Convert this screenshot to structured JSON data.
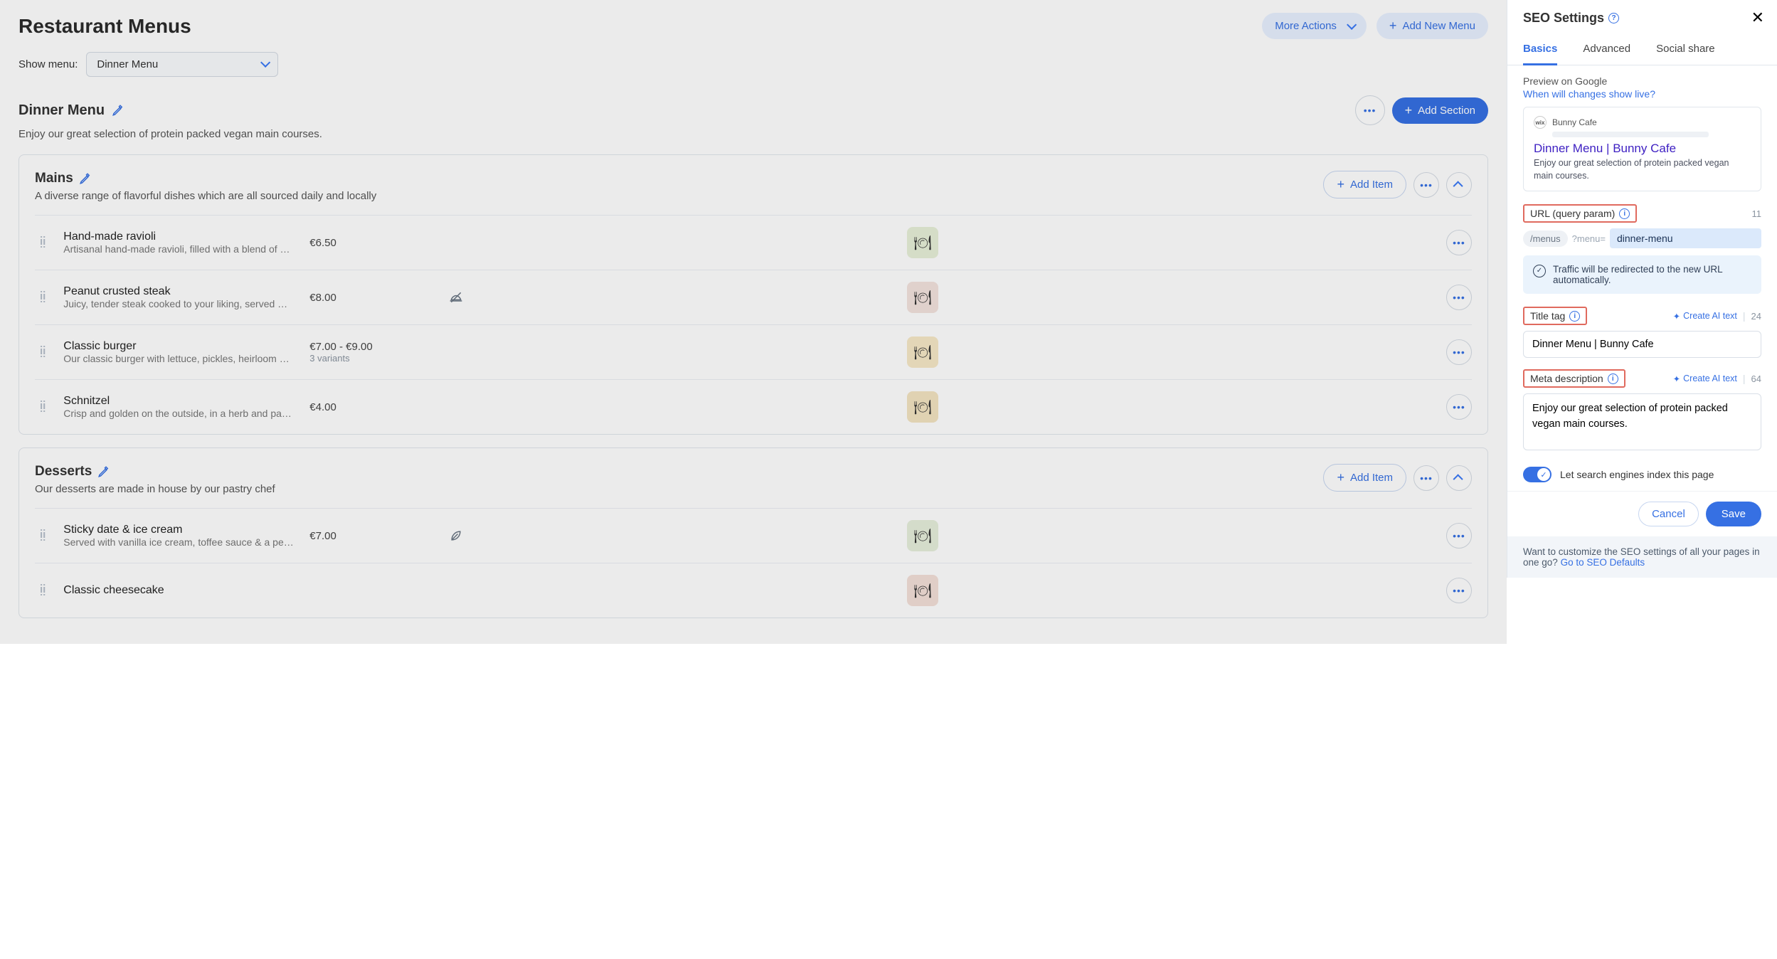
{
  "header": {
    "title": "Restaurant Menus",
    "more_actions": "More Actions",
    "add_new_menu": "Add New Menu"
  },
  "show_menu": {
    "label": "Show menu:",
    "selected": "Dinner Menu"
  },
  "menu": {
    "title": "Dinner Menu",
    "subtitle": "Enjoy our great selection of protein packed vegan main courses.",
    "add_section": "Add Section"
  },
  "sections": [
    {
      "title": "Mains",
      "subtitle": "A diverse range of flavorful dishes which are all sourced daily and locally",
      "add_item": "Add Item",
      "items": [
        {
          "name": "Hand-made ravioli",
          "desc": "Artisanal hand-made ravioli, filled with a blend of …",
          "price": "€6.50",
          "variants": "",
          "flag": "",
          "thumb": "#e8f0d8"
        },
        {
          "name": "Peanut crusted steak",
          "desc": "Juicy, tender steak cooked to your liking, served …",
          "price": "€8.00",
          "variants": "",
          "flag": "no-dish",
          "thumb": "#f3e3de"
        },
        {
          "name": "Classic burger",
          "desc": "Our classic burger with lettuce, pickles, heirloom …",
          "price": "€7.00 - €9.00",
          "variants": "3 variants",
          "flag": "",
          "thumb": "#f7e9c7"
        },
        {
          "name": "Schnitzel",
          "desc": "Crisp and golden on the outside, in a herb and pa…",
          "price": "€4.00",
          "variants": "",
          "flag": "",
          "thumb": "#f3e4c2"
        }
      ]
    },
    {
      "title": "Desserts",
      "subtitle": "Our desserts are made in house by our pastry chef",
      "add_item": "Add Item",
      "items": [
        {
          "name": "Sticky date & ice cream",
          "desc": "Served with vanilla ice cream, toffee sauce & a pe…",
          "price": "€7.00",
          "variants": "",
          "flag": "leaf",
          "thumb": "#e7efdc"
        },
        {
          "name": "Classic cheesecake",
          "desc": "",
          "price": "",
          "variants": "",
          "flag": "",
          "thumb": "#f3e0d8"
        }
      ]
    }
  ],
  "panel": {
    "title": "SEO Settings",
    "tabs": {
      "basics": "Basics",
      "advanced": "Advanced",
      "social": "Social share"
    },
    "preview_label": "Preview on Google",
    "preview_link": "When will changes show live?",
    "goog_site": "Bunny Cafe",
    "goog_title": "Dinner Menu | Bunny Cafe",
    "goog_desc": "Enjoy our great selection of protein packed vegan main courses.",
    "url_label": "URL (query param)",
    "url_count": "11",
    "url_path": "/menus",
    "url_query": "?menu=",
    "url_value": "dinner-menu",
    "redirect_notice": "Traffic will be redirected to the new URL automatically.",
    "title_label": "Title tag",
    "title_ai": "Create AI text",
    "title_count": "24",
    "title_value": "Dinner Menu | Bunny Cafe",
    "meta_label": "Meta description",
    "meta_ai": "Create AI text",
    "meta_count": "64",
    "meta_value": "Enjoy our great selection of protein packed vegan main courses.",
    "index_label": "Let search engines index this page",
    "cancel": "Cancel",
    "save": "Save",
    "footer_text": "Want to customize the SEO settings of all your pages in one go? ",
    "footer_link": "Go to SEO Defaults"
  }
}
